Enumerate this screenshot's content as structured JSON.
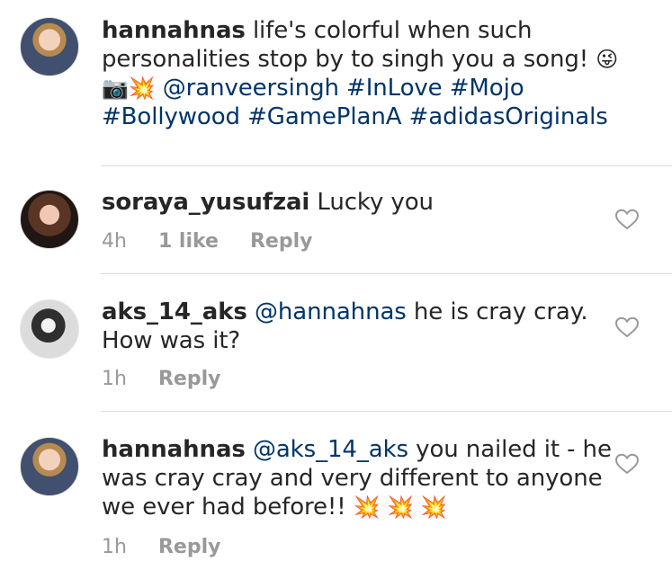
{
  "caption": {
    "username": "hannahnas",
    "text": "life's colorful when such personalities stop by to singh you a song!",
    "emojis": "😜📷💥",
    "mention": "@ranveersingh",
    "hashtags": "#InLove #Mojo #Bollywood #GamePlanA #adidasOriginals"
  },
  "comments": [
    {
      "username": "soraya_yusufzai",
      "text": "Lucky you",
      "time": "4h",
      "likes": "1 like",
      "reply": "Reply"
    },
    {
      "username": "aks_14_aks",
      "mention": "@hannahnas",
      "text": "he is cray cray. How was it?",
      "time": "1h",
      "reply": "Reply"
    },
    {
      "username": "hannahnas",
      "mention": "@aks_14_aks",
      "text": "you nailed it - he was cray cray and very different to anyone we ever had before!!",
      "emojis": "💥 💥 💥",
      "time": "1h",
      "reply": "Reply"
    }
  ]
}
